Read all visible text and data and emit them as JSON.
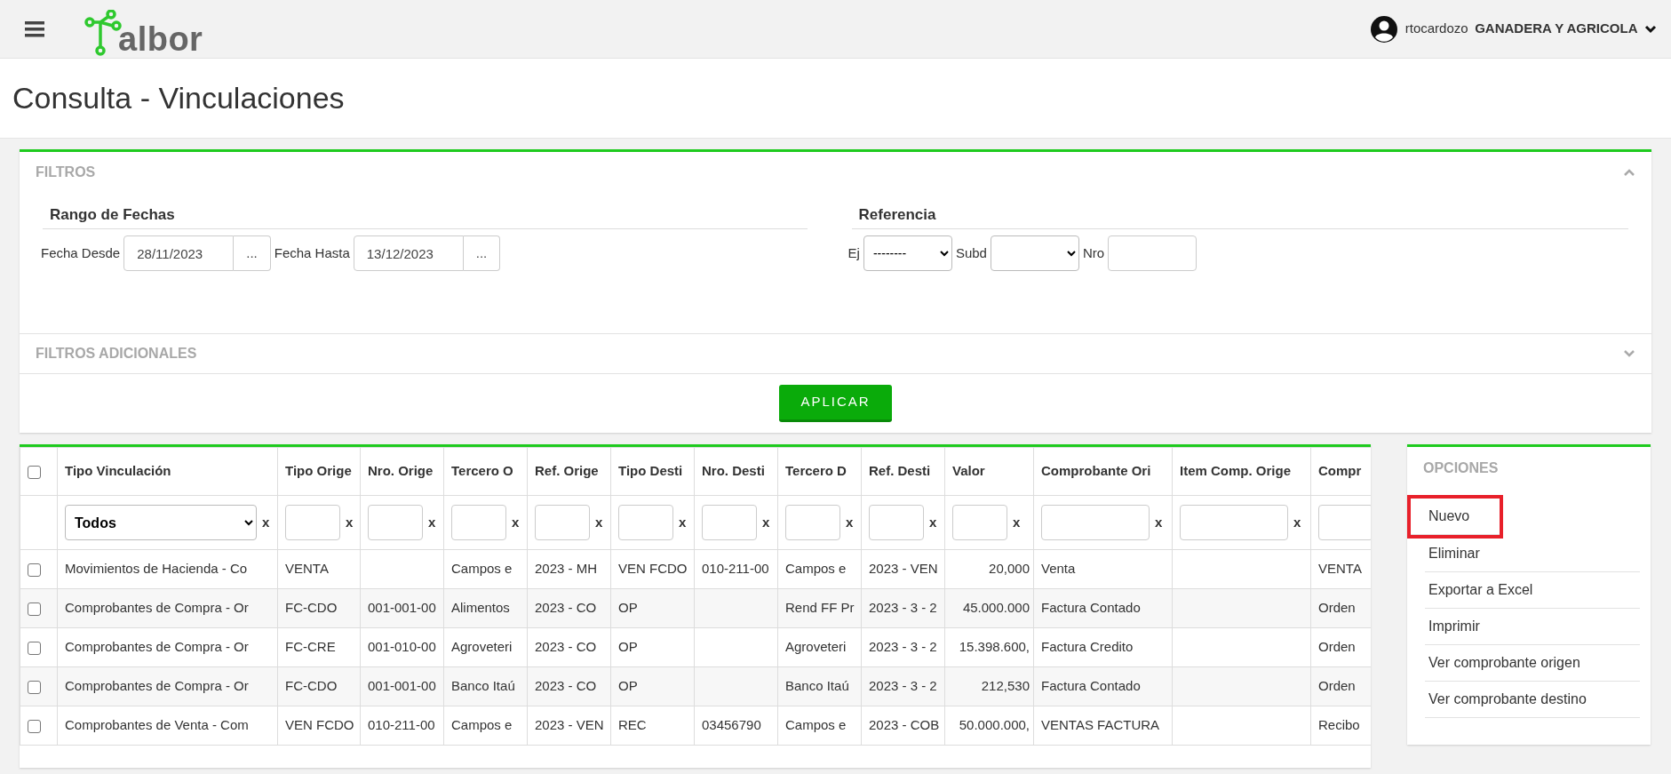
{
  "header": {
    "logo": {
      "text": "albor"
    },
    "user": {
      "name": "rtocardozo",
      "company": "GANADERA Y AGRICOLA"
    }
  },
  "page": {
    "title": "Consulta - Vinculaciones"
  },
  "filters": {
    "title": "FILTROS",
    "expanded": true,
    "date_range": {
      "title": "Rango de Fechas",
      "from_label": "Fecha Desde",
      "from_value": "28/11/2023",
      "to_label": "Fecha Hasta",
      "to_value": "13/12/2023",
      "picker_label": "..."
    },
    "reference": {
      "title": "Referencia",
      "ej_label": "Ej",
      "ej_value": "--------",
      "subd_label": "Subd",
      "nro_label": "Nro"
    },
    "additional": {
      "title": "FILTROS ADICIONALES",
      "expanded": false
    },
    "apply_button": "APLICAR"
  },
  "table": {
    "header_checked": false,
    "columns": [
      "Tipo Vinculación",
      "Tipo Orige",
      "Nro. Orige",
      "Tercero O",
      "Ref. Orige",
      "Tipo Desti",
      "Nro. Desti",
      "Tercero D",
      "Ref. Desti",
      "Valor",
      "Comprobante Ori",
      "Item Comp. Orige",
      "Compr"
    ],
    "column_filters": [
      {
        "kind": "select",
        "value": "Todos",
        "clear": "x"
      },
      {
        "kind": "input",
        "clear": "x"
      },
      {
        "kind": "input",
        "clear": "x"
      },
      {
        "kind": "input",
        "clear": "x"
      },
      {
        "kind": "input",
        "clear": "x"
      },
      {
        "kind": "input",
        "clear": "x"
      },
      {
        "kind": "input",
        "clear": "x"
      },
      {
        "kind": "input",
        "clear": "x"
      },
      {
        "kind": "input",
        "clear": "x"
      },
      {
        "kind": "input",
        "clear": "x"
      },
      {
        "kind": "input",
        "clear": "x"
      },
      {
        "kind": "input",
        "clear": "x"
      },
      {
        "kind": "input"
      }
    ],
    "rows": [
      {
        "checked": false,
        "cells": [
          "Movimientos de Hacienda - Co",
          "VENTA",
          "",
          "Campos e",
          "2023 - MH",
          "VEN FCDO",
          "010-211-00",
          "Campos e",
          "2023 - VEN",
          "20,000",
          "Venta",
          "",
          "VENTA"
        ]
      },
      {
        "checked": false,
        "cells": [
          "Comprobantes de Compra - Or",
          "FC-CDO",
          "001-001-00",
          "Alimentos",
          "2023 - CO",
          "OP",
          "",
          "Rend FF Pr",
          "2023 - 3 - 2",
          "45.000.000",
          "Factura Contado",
          "",
          "Orden"
        ]
      },
      {
        "checked": false,
        "cells": [
          "Comprobantes de Compra - Or",
          "FC-CRE",
          "001-010-00",
          "Agroveteri",
          "2023 - CO",
          "OP",
          "",
          "Agroveteri",
          "2023 - 3 - 2",
          "15.398.600,",
          "Factura Credito",
          "",
          "Orden"
        ]
      },
      {
        "checked": false,
        "cells": [
          "Comprobantes de Compra - Or",
          "FC-CDO",
          "001-001-00",
          "Banco Itaú",
          "2023 - CO",
          "OP",
          "",
          "Banco Itaú",
          "2023 - 3 - 2",
          "212,530",
          "Factura Contado",
          "",
          "Orden"
        ]
      },
      {
        "checked": false,
        "cells": [
          "Comprobantes de Venta - Com",
          "VEN FCDO",
          "010-211-00",
          "Campos e",
          "2023 - VEN",
          "REC",
          "03456790",
          "Campos e",
          "2023 - COB",
          "50.000.000,",
          "VENTAS FACTURA",
          "",
          "Recibo"
        ]
      }
    ]
  },
  "options": {
    "title": "OPCIONES",
    "items": [
      {
        "label": "Nuevo",
        "highlighted": true
      },
      {
        "label": "Eliminar",
        "highlighted": false
      },
      {
        "label": "Exportar a Excel",
        "highlighted": false
      },
      {
        "label": "Imprimir",
        "highlighted": false
      },
      {
        "label": "Ver comprobante origen",
        "highlighted": false
      },
      {
        "label": "Ver comprobante destino",
        "highlighted": false
      }
    ]
  }
}
